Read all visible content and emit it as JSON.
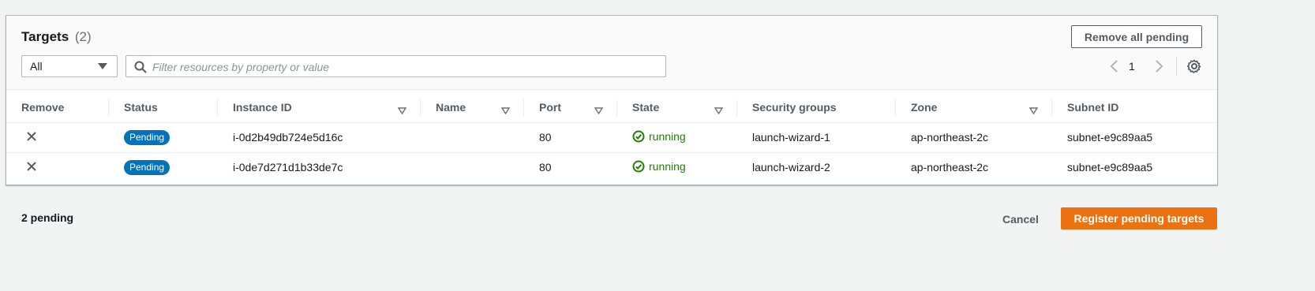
{
  "header": {
    "title": "Targets",
    "count": "(2)",
    "remove_all_label": "Remove all pending"
  },
  "filter": {
    "select_value": "All",
    "search_placeholder": "Filter resources by property or value"
  },
  "pagination": {
    "current_page": "1"
  },
  "table": {
    "columns": [
      "Remove",
      "Status",
      "Instance ID",
      "Name",
      "Port",
      "State",
      "Security groups",
      "Zone",
      "Subnet ID"
    ],
    "rows": [
      {
        "status": "Pending",
        "instance_id": "i-0d2b49db724e5d16c",
        "name": "",
        "port": "80",
        "state": "running",
        "security_group": "launch-wizard-1",
        "zone": "ap-northeast-2c",
        "subnet_id": "subnet-e9c89aa5"
      },
      {
        "status": "Pending",
        "instance_id": "i-0de7d271d1b33de7c",
        "name": "",
        "port": "80",
        "state": "running",
        "security_group": "launch-wizard-2",
        "zone": "ap-northeast-2c",
        "subnet_id": "subnet-e9c89aa5"
      }
    ]
  },
  "footer": {
    "pending_text": "2 pending",
    "cancel_label": "Cancel",
    "register_label": "Register pending targets"
  },
  "colors": {
    "primary": "#ec7211",
    "badge": "#0073bb",
    "success": "#1d8102"
  }
}
